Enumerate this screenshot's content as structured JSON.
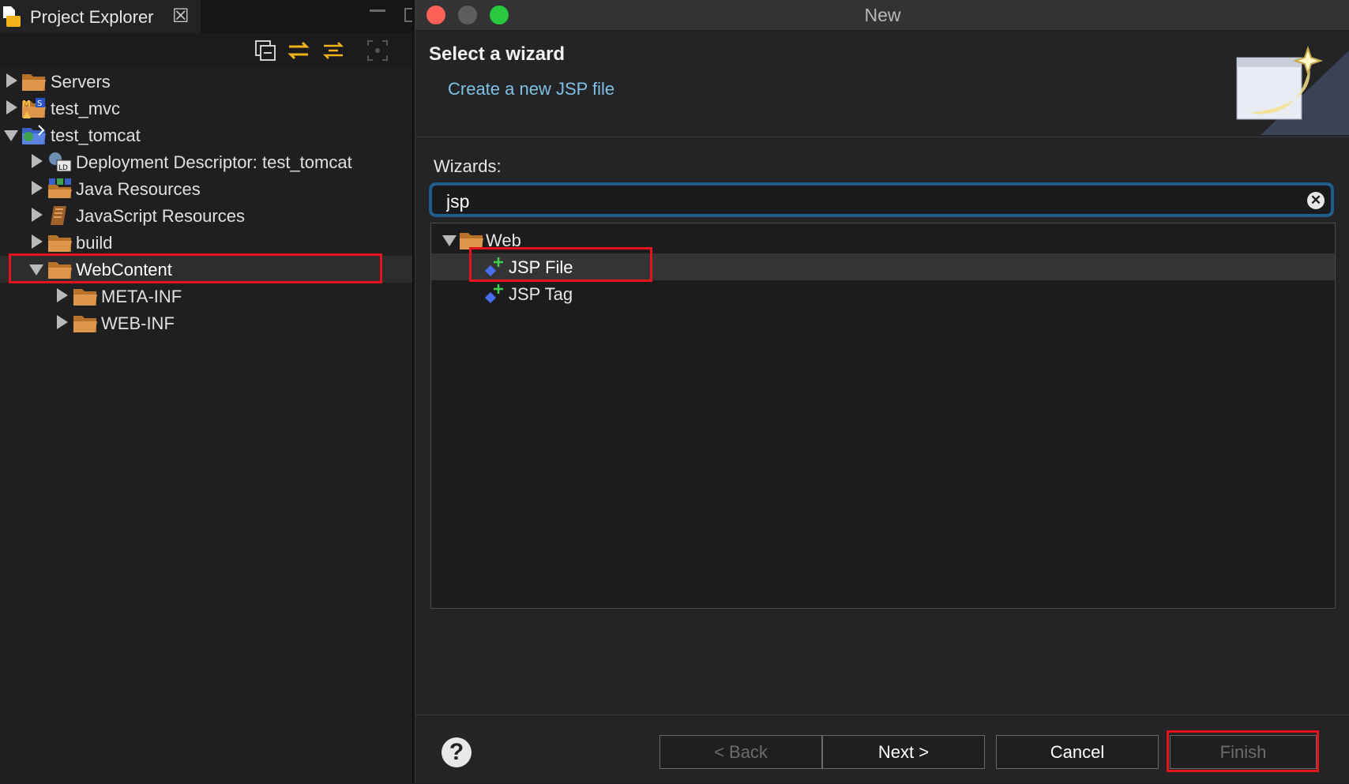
{
  "explorer": {
    "tab_title": "Project Explorer",
    "tab_close": "☒",
    "toolbar": [
      "collapse-all-icon",
      "link-with-editor-icon",
      "filter-icon",
      "focus-icon"
    ],
    "items": [
      {
        "label": "Servers",
        "icon": "folder-icon",
        "expanded": false
      },
      {
        "label": "test_mvc",
        "icon": "maven-project-icon",
        "expanded": false
      },
      {
        "label": "test_tomcat",
        "icon": "web-project-icon",
        "expanded": true
      },
      {
        "label": "Deployment Descriptor: test_tomcat",
        "icon": "deployment-descriptor-icon",
        "expanded": false
      },
      {
        "label": "Java Resources",
        "icon": "java-resources-icon",
        "expanded": false
      },
      {
        "label": "JavaScript Resources",
        "icon": "javascript-resources-icon",
        "expanded": false
      },
      {
        "label": "build",
        "icon": "folder-icon",
        "expanded": false
      },
      {
        "label": "WebContent",
        "icon": "folder-icon",
        "expanded": true,
        "selected": true
      },
      {
        "label": "META-INF",
        "icon": "folder-icon",
        "expanded": false
      },
      {
        "label": "WEB-INF",
        "icon": "folder-icon",
        "expanded": false
      }
    ]
  },
  "dialog": {
    "title": "New",
    "heading": "Select a wizard",
    "message": "Create a new JSP file",
    "wizards_label": "Wizards:",
    "filter_value": "jsp",
    "clear_glyph": "✕",
    "tree": [
      {
        "label": "Web",
        "icon": "folder-icon",
        "expanded": true
      },
      {
        "label": "JSP File",
        "icon": "jsp-file-wizard-icon",
        "selected": true
      },
      {
        "label": "JSP Tag",
        "icon": "jsp-tag-wizard-icon"
      }
    ],
    "buttons": {
      "help": "?",
      "back": "< Back",
      "next": "Next >",
      "cancel": "Cancel",
      "finish": "Finish"
    }
  },
  "colors": {
    "highlight_box": "#e3141c",
    "folder": "#d58b3a",
    "message_link": "#7fc1e2",
    "focus_ring": "#1f5d8c"
  }
}
